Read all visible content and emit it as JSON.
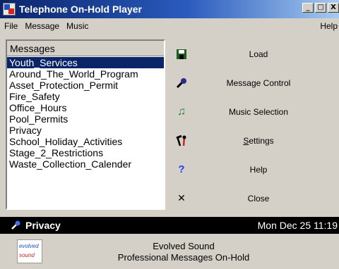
{
  "window": {
    "title": "Telephone On-Hold Player",
    "controls": [
      "_",
      "□",
      "X"
    ]
  },
  "menu": {
    "items": [
      "File",
      "Message",
      "Music"
    ],
    "help": "Help"
  },
  "messages": {
    "header": "Messages",
    "items": [
      "Youth_Services",
      "Around_The_World_Program",
      "Asset_Protection_Permit",
      "Fire_Safety",
      "Office_Hours",
      "Pool_Permits",
      "Privacy",
      "School_Holiday_Activities",
      "Stage_2_Restrictions",
      "Waste_Collection_Calender"
    ],
    "selected": "Youth_Services"
  },
  "buttons": [
    {
      "label": "Load",
      "icon": "floppy-disk-icon"
    },
    {
      "label": "Message Control",
      "icon": "microphone-icon"
    },
    {
      "label": "Music Selection",
      "icon": "music-note-icon"
    },
    {
      "label": "Settings",
      "icon": "tools-icon"
    },
    {
      "label": "Help",
      "icon": "question-mark-icon"
    },
    {
      "label": "Close",
      "icon": "close-icon"
    }
  ],
  "status": {
    "current_message": "Privacy",
    "datetime": "Mon Dec 25 11:19"
  },
  "footer": {
    "line1": "Evolved Sound",
    "line2": "Professional Messages On-Hold",
    "logo_top": "evolved",
    "logo_bottom": "sound"
  },
  "colors": {
    "selection": "#0a246a",
    "status_bg": "#000000"
  }
}
